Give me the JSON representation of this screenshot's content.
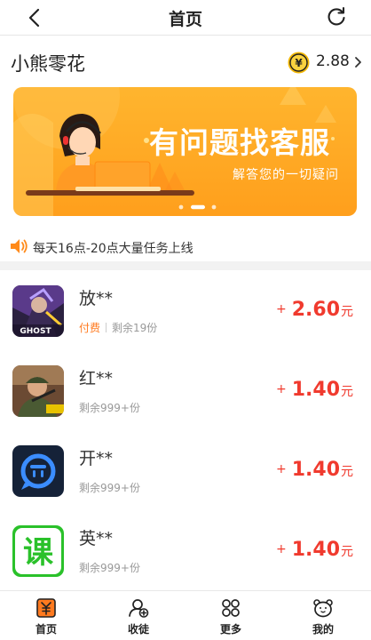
{
  "header": {
    "title": "首页",
    "back_icon": "chevron-left-icon",
    "refresh_icon": "refresh-icon"
  },
  "user": {
    "name": "小熊零花",
    "coin_symbol": "¥",
    "balance": "2.88"
  },
  "banner": {
    "headline": "有问题找客服",
    "subline": "解答您的一切疑问",
    "slide_count": 3,
    "active_slide": 2,
    "colors": {
      "start": "#ffb52e",
      "end": "#ff9f1c"
    }
  },
  "notice": {
    "text": "每天16点-20点大量任务上线"
  },
  "tasks": [
    {
      "name": "放**",
      "paid_label": "付费",
      "remaining": "剩余19份",
      "plus": "+",
      "price": "2.60",
      "unit": "元",
      "icon": "game-ghost-icon"
    },
    {
      "name": "红**",
      "remaining": "剩余999+份",
      "plus": "+",
      "price": "1.40",
      "unit": "元",
      "icon": "game-soldier-icon"
    },
    {
      "name": "开**",
      "remaining": "剩余999+份",
      "plus": "+",
      "price": "1.40",
      "unit": "元",
      "icon": "chat-bot-icon"
    },
    {
      "name": "英**",
      "remaining": "剩余999+份",
      "plus": "+",
      "price": "1.40",
      "unit": "元",
      "icon": "ke-course-icon",
      "icon_text": "课"
    }
  ],
  "tabbar": {
    "tabs": [
      {
        "label": "首页",
        "icon": "home-yuan-icon",
        "active": true
      },
      {
        "label": "收徒",
        "icon": "add-apprentice-icon"
      },
      {
        "label": "更多",
        "icon": "grid-more-icon"
      },
      {
        "label": "我的",
        "icon": "bear-profile-icon"
      }
    ]
  },
  "colors": {
    "accent": "#ff9f1c",
    "price": "#f03a2e",
    "paid": "#ff7a1f"
  }
}
